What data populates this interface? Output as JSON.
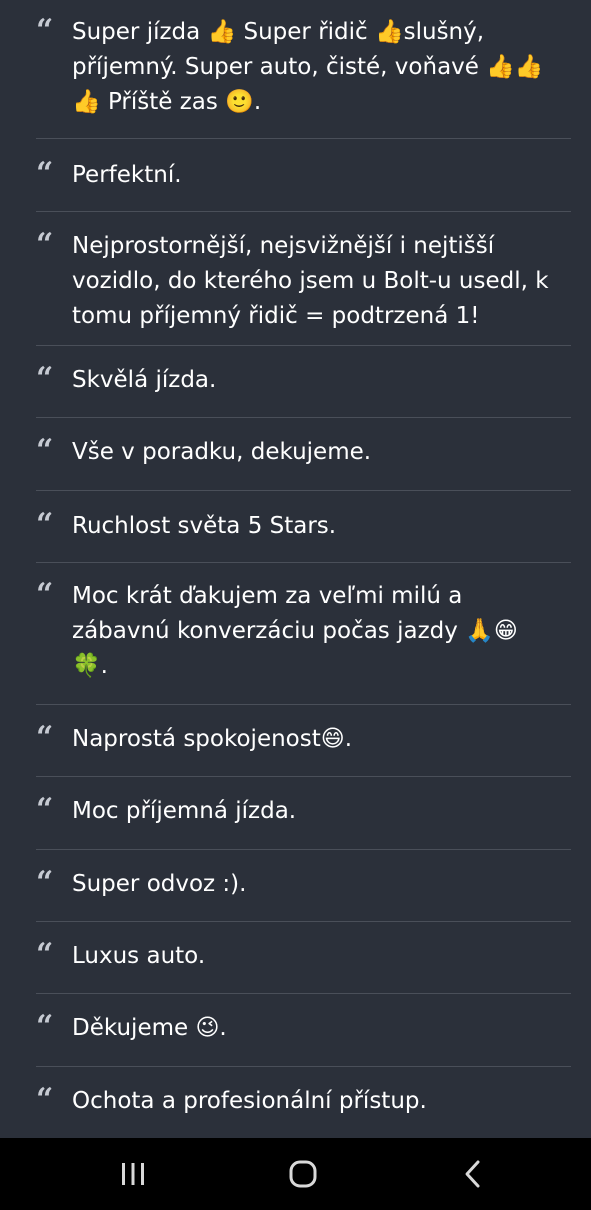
{
  "reviews": [
    {
      "text": "Super jízda 👍 Super řidič 👍slušný,\npříjemný. Super auto, čisté, voňavé 👍👍\n👍 Příště zas 🙂."
    },
    {
      "text": "Perfektní."
    },
    {
      "text": "Nejprostornější, nejsvižnější i nejtišší\nvozidlo, do kterého jsem u Bolt-u usedl, k\ntomu příjemný řidič = podtrzená 1!"
    },
    {
      "text": "Skvělá jízda."
    },
    {
      "text": "Vše v poradku, dekujeme."
    },
    {
      "text": "Ruchlost světa 5 Stars."
    },
    {
      "text": "Moc krát ďakujem za veľmi milú a\nzábavnú konverzáciu počas jazdy 🙏😁\n🍀."
    },
    {
      "text": "Naprostá spokojenost😄."
    },
    {
      "text": "Moc příjemná jízda."
    },
    {
      "text": "Super odvoz :)."
    },
    {
      "text": "Luxus auto."
    },
    {
      "text": "Děkujeme 😉."
    },
    {
      "text": "Ochota a profesionální přístup."
    }
  ],
  "quote_glyph": "“",
  "navbar": {
    "recent_apps": "recent-apps-icon",
    "home": "home-icon",
    "back": "back-icon"
  },
  "colors": {
    "background": "#2b303a",
    "divider": "#4a4f59",
    "quote_mark": "#c6cad2",
    "text": "#ffffff",
    "navbar": "#000000"
  }
}
